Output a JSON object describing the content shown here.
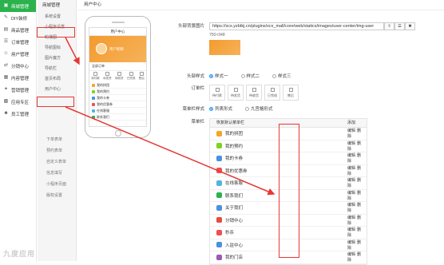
{
  "sidebar": {
    "items": [
      {
        "label": "商城管理",
        "icon": "shop-icon",
        "active": true
      },
      {
        "label": "DIY装修",
        "icon": "brush-icon"
      },
      {
        "label": "商品管理",
        "icon": "box-icon"
      },
      {
        "label": "订单管理",
        "icon": "order-icon"
      },
      {
        "label": "用户管理",
        "icon": "user-icon"
      },
      {
        "label": "分销中心",
        "icon": "share-icon"
      },
      {
        "label": "内容管理",
        "icon": "content-icon"
      },
      {
        "label": "营销管理",
        "icon": "marketing-icon"
      },
      {
        "label": "应用专区",
        "icon": "apps-icon"
      },
      {
        "label": "员工管理",
        "icon": "staff-icon"
      }
    ]
  },
  "subnav": {
    "title": "商城管理",
    "items": [
      "系统设置",
      "小程序设置",
      "轮播图",
      "导航图标",
      "图片魔方",
      "导航栏",
      "首页布局",
      "用户中心"
    ],
    "col3": [
      "下单表单",
      "预约表单",
      "自定义表单",
      "信息填写",
      "小程序页面",
      "版权设置"
    ]
  },
  "header": {
    "title": "用户中心"
  },
  "phone": {
    "title": "用户中心",
    "username": "用户昵称",
    "orders_label": "全部订单",
    "order_icons": [
      "待付款",
      "待发货",
      "待收货",
      "已完成",
      "售后"
    ],
    "menu": [
      "我的拼团",
      "我的预约",
      "我的卡券",
      "我的优惠券",
      "在线客服",
      "联系我们"
    ]
  },
  "form": {
    "bg_label": "头部背景图片",
    "bg_url": "https://xcx.yzbtkj.cn/plugins/xcx_mall/core/web/statics/images/user-center/img-user",
    "bg_size": "750×348",
    "btn_upload": "⇪",
    "btn_pick": "☰",
    "btn_del": "✖",
    "header_style_label": "头部样式",
    "header_styles": [
      "样式一",
      "样式二",
      "样式三"
    ],
    "order_bar_label": "订单栏",
    "order_tiles": [
      "待付款",
      "待发货",
      "待收货",
      "已完成",
      "售后"
    ],
    "menu_style_label": "菜单栏样式",
    "menu_styles": [
      "列表形式",
      "九宫格形式"
    ],
    "menu_label": "菜单栏",
    "table_head": {
      "col1": "恢复默认菜单栏",
      "col2": "添加"
    },
    "edit": "编辑",
    "del": "删除",
    "menu_rows": [
      {
        "label": "我的拼团",
        "color": "#f5a623"
      },
      {
        "label": "我的预约",
        "color": "#7ed321"
      },
      {
        "label": "我的卡券",
        "color": "#4a90e2"
      },
      {
        "label": "我的优惠券",
        "color": "#f05050"
      },
      {
        "label": "在线客服",
        "color": "#50b5e0"
      },
      {
        "label": "联系我们",
        "color": "#2bb24c"
      },
      {
        "label": "关于我们",
        "color": "#4a90e2"
      },
      {
        "label": "分销中心",
        "color": "#e74c3c"
      },
      {
        "label": "秒杀",
        "color": "#f05050"
      },
      {
        "label": "入驻中心",
        "color": "#4a90e2"
      },
      {
        "label": "我的门店",
        "color": "#9b59b6"
      }
    ]
  },
  "watermark": "九度应用"
}
